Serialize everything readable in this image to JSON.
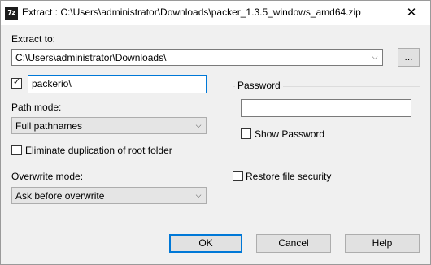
{
  "window": {
    "icon_text": "7z",
    "title": "Extract : C:\\Users\\administrator\\Downloads\\packer_1.3.5_windows_amd64.zip",
    "close_symbol": "✕"
  },
  "extract_to": {
    "label": "Extract to:",
    "path": "C:\\Users\\administrator\\Downloads\\",
    "browse_label": "...",
    "dropdown_symbol": "⌵"
  },
  "subfolder": {
    "checked": true,
    "check_symbol": "✓",
    "value": "packerio\\"
  },
  "path_mode": {
    "label": "Path mode:",
    "selected": "Full pathnames",
    "dropdown_symbol": "⌵"
  },
  "eliminate_duplication": {
    "checked": false,
    "label": "Eliminate duplication of root folder"
  },
  "overwrite_mode": {
    "label": "Overwrite mode:",
    "selected": "Ask before overwrite",
    "dropdown_symbol": "⌵"
  },
  "password": {
    "group_label": "Password",
    "value": "",
    "show_password_checked": false,
    "show_password_label": "Show Password"
  },
  "restore_security": {
    "checked": false,
    "label": "Restore file security"
  },
  "buttons": {
    "ok": "OK",
    "cancel": "Cancel",
    "help": "Help"
  }
}
